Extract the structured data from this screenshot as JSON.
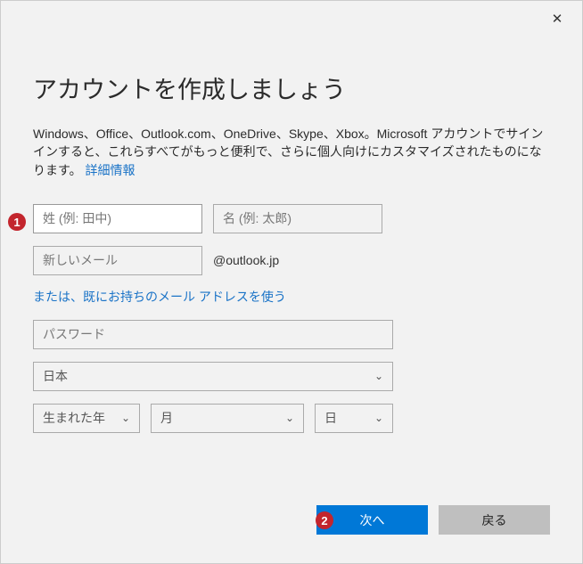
{
  "window": {
    "close_label": "✕"
  },
  "title": "アカウントを作成しましょう",
  "description_text": "Windows、Office、Outlook.com、OneDrive、Skype、Xbox。Microsoft アカウントでサインインすると、これらすべてがもっと便利で、さらに個人向けにカスタマイズされたものになります。",
  "more_info_link": "詳細情報",
  "fields": {
    "lastname_placeholder": "姓 (例: 田中)",
    "firstname_placeholder": "名 (例: 太郎)",
    "email_placeholder": "新しいメール",
    "email_domain": "@outlook.jp",
    "use_existing_email": "または、既にお持ちのメール アドレスを使う",
    "password_placeholder": "パスワード",
    "country_value": "日本",
    "year_value": "生まれた年",
    "month_value": "月",
    "day_value": "日"
  },
  "buttons": {
    "next": "次へ",
    "back": "戻る"
  },
  "annotations": {
    "one": "1",
    "two": "2"
  }
}
